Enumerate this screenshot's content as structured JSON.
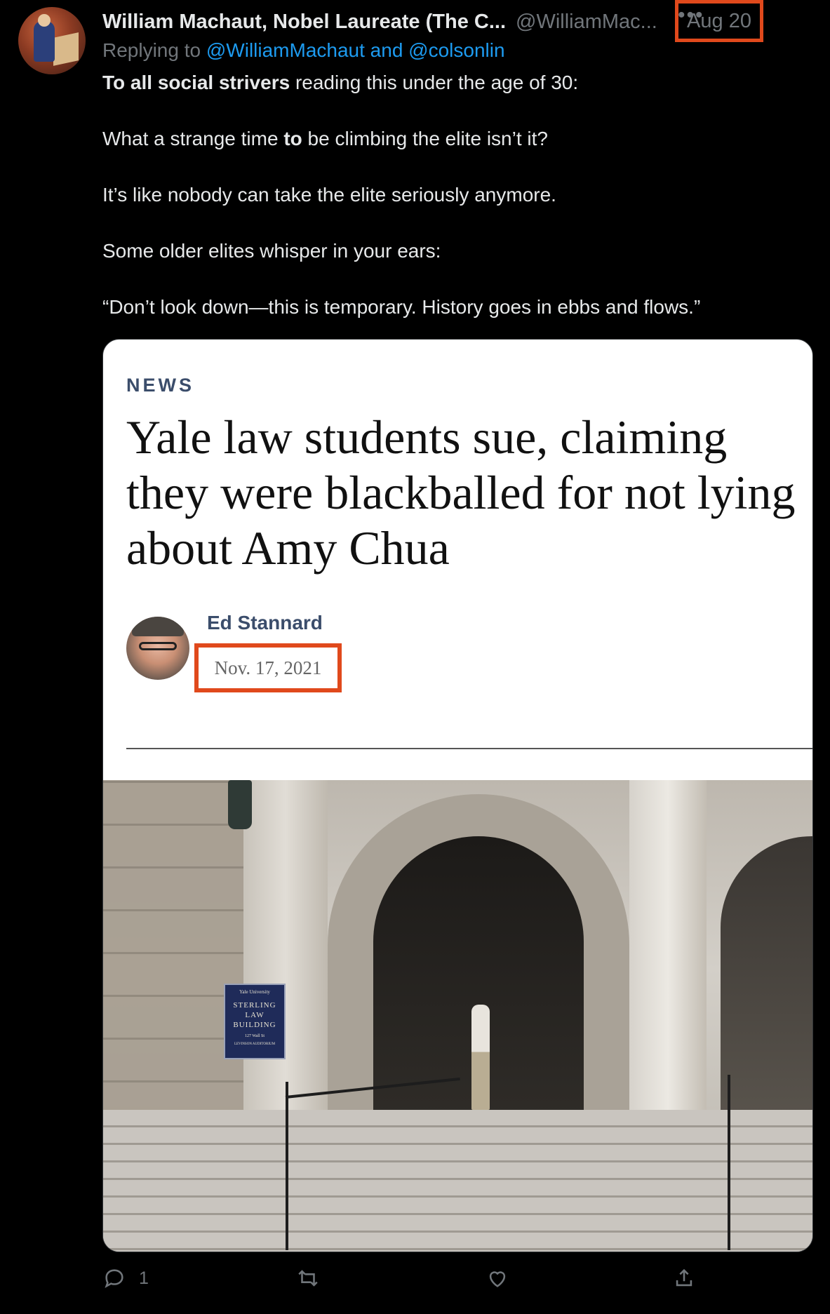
{
  "tweet": {
    "author_name": "William Machaut, Nobel Laureate (The C...",
    "handle": "@WilliamMac...",
    "date": "Aug 20",
    "more_icon": "more-icon",
    "replying_prefix": "Replying to",
    "replying_to": "@WilliamMachaut and @colsonlin",
    "text": {
      "p1_bold": "To all social strivers",
      "p1_rest": " reading this under the age of 30:",
      "p2_a": "What a strange time ",
      "p2_bold": "to",
      "p2_b": " be climbing the elite isn’t it?",
      "p3": "It’s like nobody can take the elite seriously anymore.",
      "p4": "Some older elites whisper in your ears:",
      "p5": "“Don’t look down—this is temporary. History goes in ebbs and flows.”"
    }
  },
  "card": {
    "section": "NEWS",
    "headline": "Yale law students sue, claiming they were blackballed for not lying about Amy Chua",
    "author": "Ed Stannard",
    "published": "Nov. 17, 2021",
    "sign": {
      "line1": "Yale University",
      "line2": "STERLING",
      "line3": "LAW",
      "line4": "BUILDING",
      "line5": "127 Wall St",
      "line6": "LEVINSON AUDITORIUM"
    }
  },
  "actions": {
    "reply_count": "1",
    "icons": [
      "reply-icon",
      "retweet-icon",
      "like-icon",
      "share-icon"
    ]
  },
  "colors": {
    "background": "#000000",
    "link": "#1d9bf0",
    "highlight_box": "#e0491c",
    "muted": "#71767b"
  }
}
